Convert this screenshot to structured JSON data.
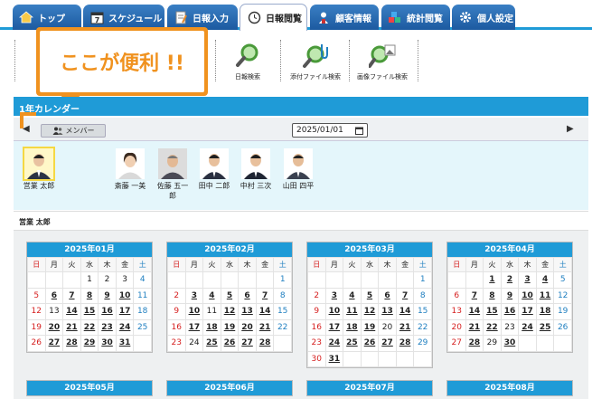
{
  "tabs": [
    {
      "label": "トップ",
      "icon": "house-icon"
    },
    {
      "label": "スケジュール",
      "icon": "calendar-icon"
    },
    {
      "label": "日報入力",
      "icon": "notepad-icon"
    },
    {
      "label": "日報閲覧",
      "icon": "clock-icon",
      "active": true
    },
    {
      "label": "顧客情報",
      "icon": "person-icon"
    },
    {
      "label": "統計閲覧",
      "icon": "blocks-icon"
    },
    {
      "label": "個人設定",
      "icon": "gear-icon"
    }
  ],
  "toolbar": {
    "report_search": "日報検索",
    "attach_search": "添付ファイル検索",
    "image_search": "画像ファイル検索"
  },
  "balloon": {
    "text": "ここが便利 !!"
  },
  "panel": {
    "title": "1年カレンダー"
  },
  "nav": {
    "member_label": "メンバー",
    "date_value": "2025/01/01",
    "prev": "◀",
    "next": "▶"
  },
  "members": [
    {
      "name": "営業 太郎",
      "selected": true
    },
    {
      "name": "斎藤 一美"
    },
    {
      "name": "佐藤 五一郎"
    },
    {
      "name": "田中 二郎"
    },
    {
      "name": "中村 三次"
    },
    {
      "name": "山田 四平"
    }
  ],
  "selected_member": "営業 太郎",
  "weekdays": [
    "日",
    "月",
    "火",
    "水",
    "木",
    "金",
    "土"
  ],
  "months": [
    {
      "title": "2025年01月",
      "weeks": [
        [
          "",
          "",
          "",
          "1",
          "2",
          "3",
          "4"
        ],
        [
          "5",
          "6",
          "7",
          "8",
          "9",
          "10",
          "11"
        ],
        [
          "12",
          "13",
          "14",
          "15",
          "16",
          "17",
          "18"
        ],
        [
          "19",
          "20",
          "21",
          "22",
          "23",
          "24",
          "25"
        ],
        [
          "26",
          "27",
          "28",
          "29",
          "30",
          "31",
          ""
        ]
      ]
    },
    {
      "title": "2025年02月",
      "weeks": [
        [
          "",
          "",
          "",
          "",
          "",
          "",
          "1"
        ],
        [
          "2",
          "3",
          "4",
          "5",
          "6",
          "7",
          "8"
        ],
        [
          "9",
          "10",
          "11",
          "12",
          "13",
          "14",
          "15"
        ],
        [
          "16",
          "17",
          "18",
          "19",
          "20",
          "21",
          "22"
        ],
        [
          "23",
          "24",
          "25",
          "26",
          "27",
          "28",
          ""
        ]
      ]
    },
    {
      "title": "2025年03月",
      "weeks": [
        [
          "",
          "",
          "",
          "",
          "",
          "",
          "1"
        ],
        [
          "2",
          "3",
          "4",
          "5",
          "6",
          "7",
          "8"
        ],
        [
          "9",
          "10",
          "11",
          "12",
          "13",
          "14",
          "15"
        ],
        [
          "16",
          "17",
          "18",
          "19",
          "20",
          "21",
          "22"
        ],
        [
          "23",
          "24",
          "25",
          "26",
          "27",
          "28",
          "29"
        ],
        [
          "30",
          "31",
          "",
          "",
          "",
          "",
          ""
        ]
      ]
    },
    {
      "title": "2025年04月",
      "weeks": [
        [
          "",
          "",
          "1",
          "2",
          "3",
          "4",
          "5"
        ],
        [
          "6",
          "7",
          "8",
          "9",
          "10",
          "11",
          "12"
        ],
        [
          "13",
          "14",
          "15",
          "16",
          "17",
          "18",
          "19"
        ],
        [
          "20",
          "21",
          "22",
          "23",
          "24",
          "25",
          "26"
        ],
        [
          "27",
          "28",
          "29",
          "30",
          "",
          "",
          ""
        ]
      ]
    },
    {
      "title": "2025年05月",
      "weeks": []
    },
    {
      "title": "2025年06月",
      "weeks": []
    },
    {
      "title": "2025年07月",
      "weeks": []
    },
    {
      "title": "2025年08月",
      "weeks": []
    }
  ],
  "colors": {
    "accent": "#1f9bd7",
    "balloon": "#f0921f",
    "sunday": "#d62020",
    "saturday": "#1f7fc0"
  }
}
